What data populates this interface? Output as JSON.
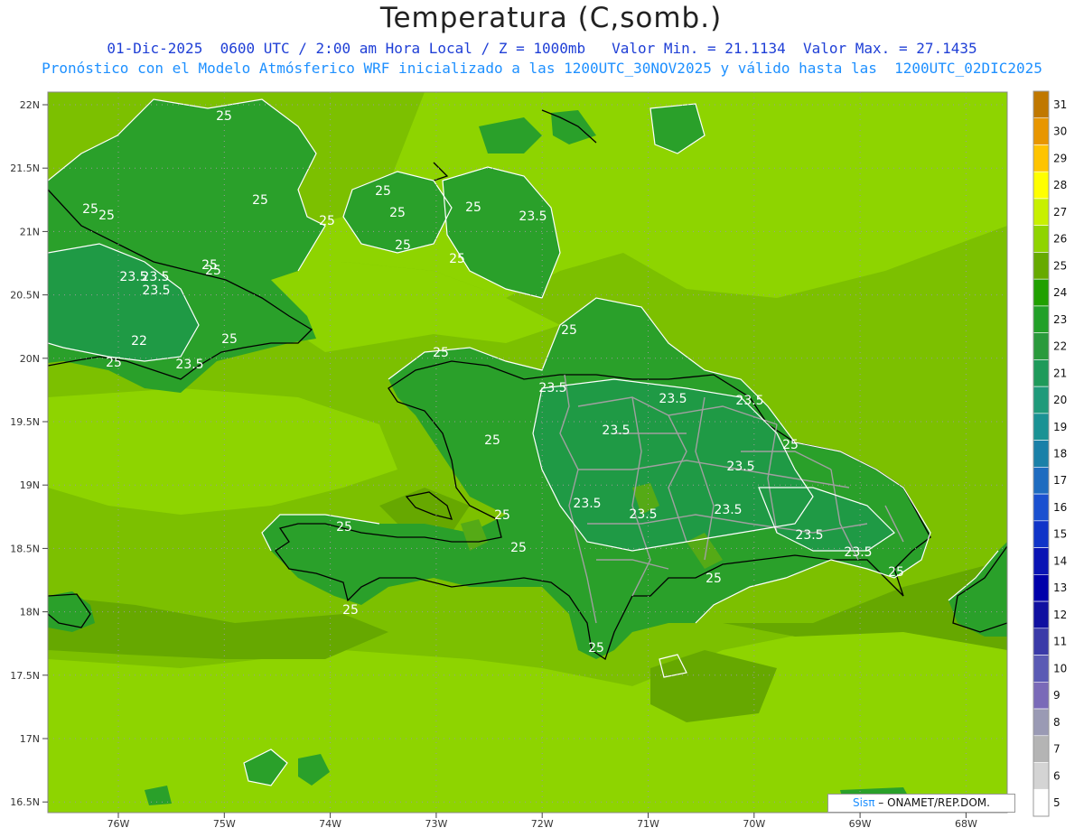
{
  "header": {
    "title": "Temperatura (C,somb.)",
    "subtitle_line1": "01-Dic-2025  0600 UTC / 2:00 am Hora Local / Z = 1000mb   Valor Min. = 21.1134  Valor Max. = 27.1435",
    "subtitle_line2": "Pronóstico con el Modelo Atmósferico WRF inicializado a las 1200UTC_30NOV2025 y válido hasta las  1200UTC_02DIC2025"
  },
  "map": {
    "lat_labels": [
      "22N",
      "21.5N",
      "21N",
      "20.5N",
      "20N",
      "19.5N",
      "19N",
      "18.5N",
      "18N",
      "17.5N",
      "17N",
      "16.5N"
    ],
    "lon_labels": [
      "76W",
      "75W",
      "74W",
      "73W",
      "72W",
      "71W",
      "70W",
      "69W",
      "68W"
    ],
    "contour_labels": [
      "25",
      "25",
      "25",
      "25",
      "25",
      "25",
      "25",
      "23.5",
      "23.5",
      "23.5",
      "22",
      "25",
      "25",
      "23.5",
      "25",
      "25",
      "25",
      "25",
      "23.5",
      "23.5",
      "23.5",
      "23.5",
      "25",
      "25",
      "23.5",
      "23.5",
      "23.5",
      "25",
      "25",
      "23.5",
      "23.5",
      "25",
      "25",
      "25",
      "25",
      "25",
      "23.5",
      "23.5",
      "25",
      "25",
      "25"
    ],
    "colors": {
      "ocean_lo": "#66a800",
      "ocean_mid": "#7cc000",
      "ocean_hi": "#8ed400",
      "land_mid": "#2aa02a",
      "land_lo": "#1f9a45",
      "land_hi": "#55aa16",
      "coast": "#000000",
      "border": "#9a9a9a",
      "contour": "#ffffff"
    }
  },
  "colorbar": {
    "labels": [
      "31",
      "30",
      "29",
      "28",
      "27",
      "26",
      "25",
      "24",
      "23",
      "22",
      "21",
      "20",
      "19",
      "18",
      "17",
      "16",
      "15",
      "14",
      "13",
      "12",
      "11",
      "10",
      "9",
      "8",
      "7",
      "6",
      "5"
    ],
    "colors": [
      "#c07800",
      "#e89600",
      "#ffc400",
      "#ffff00",
      "#c8f000",
      "#8fd400",
      "#66aa00",
      "#20a000",
      "#22a028",
      "#2a9a3c",
      "#1e9a5a",
      "#1f9a7a",
      "#1a9294",
      "#1a80a8",
      "#1e6cc0",
      "#1a50d0",
      "#1034c8",
      "#0a14b4",
      "#0000aa",
      "#1010a0",
      "#3a3aa8",
      "#5a5ab4",
      "#7a6ab8",
      "#9a9ab4",
      "#b4b4b4",
      "#d4d4d4",
      "#ffffff"
    ]
  },
  "credit": {
    "brand": "Sis",
    "pi": "π",
    "rest": "– ONAMET/REP.DOM."
  }
}
